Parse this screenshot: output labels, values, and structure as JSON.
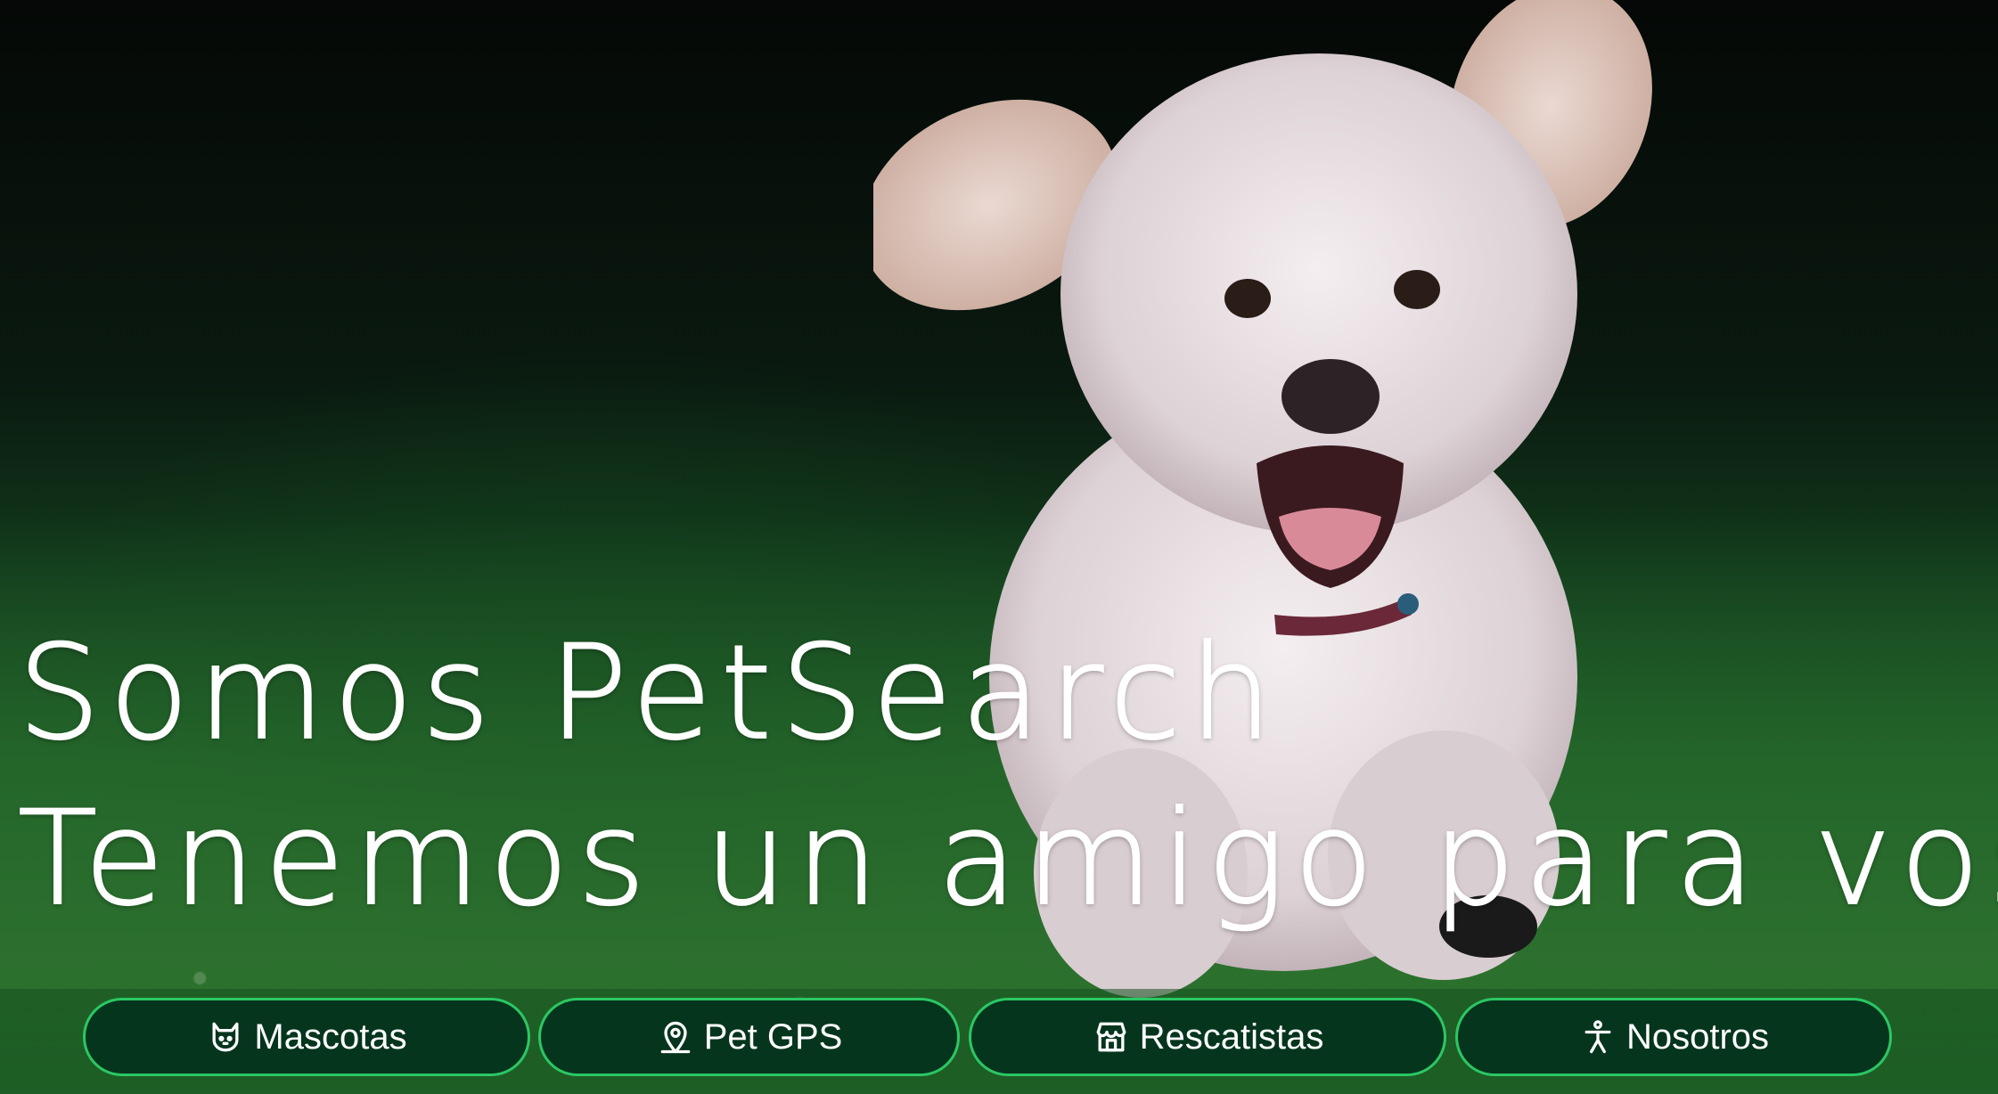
{
  "hero": {
    "headline_line1": "Somos PetSearch",
    "headline_line2": "Tenemos un amigo para vos"
  },
  "nav": {
    "items": [
      {
        "label": "Mascotas",
        "icon": "cat-face-icon"
      },
      {
        "label": "Pet GPS",
        "icon": "map-pin-icon"
      },
      {
        "label": "Rescatistas",
        "icon": "storefront-icon"
      },
      {
        "label": "Nosotros",
        "icon": "person-icon"
      }
    ]
  },
  "colors": {
    "button_bg": "#06351d",
    "button_border": "#2bc764",
    "text": "#ffffff"
  }
}
